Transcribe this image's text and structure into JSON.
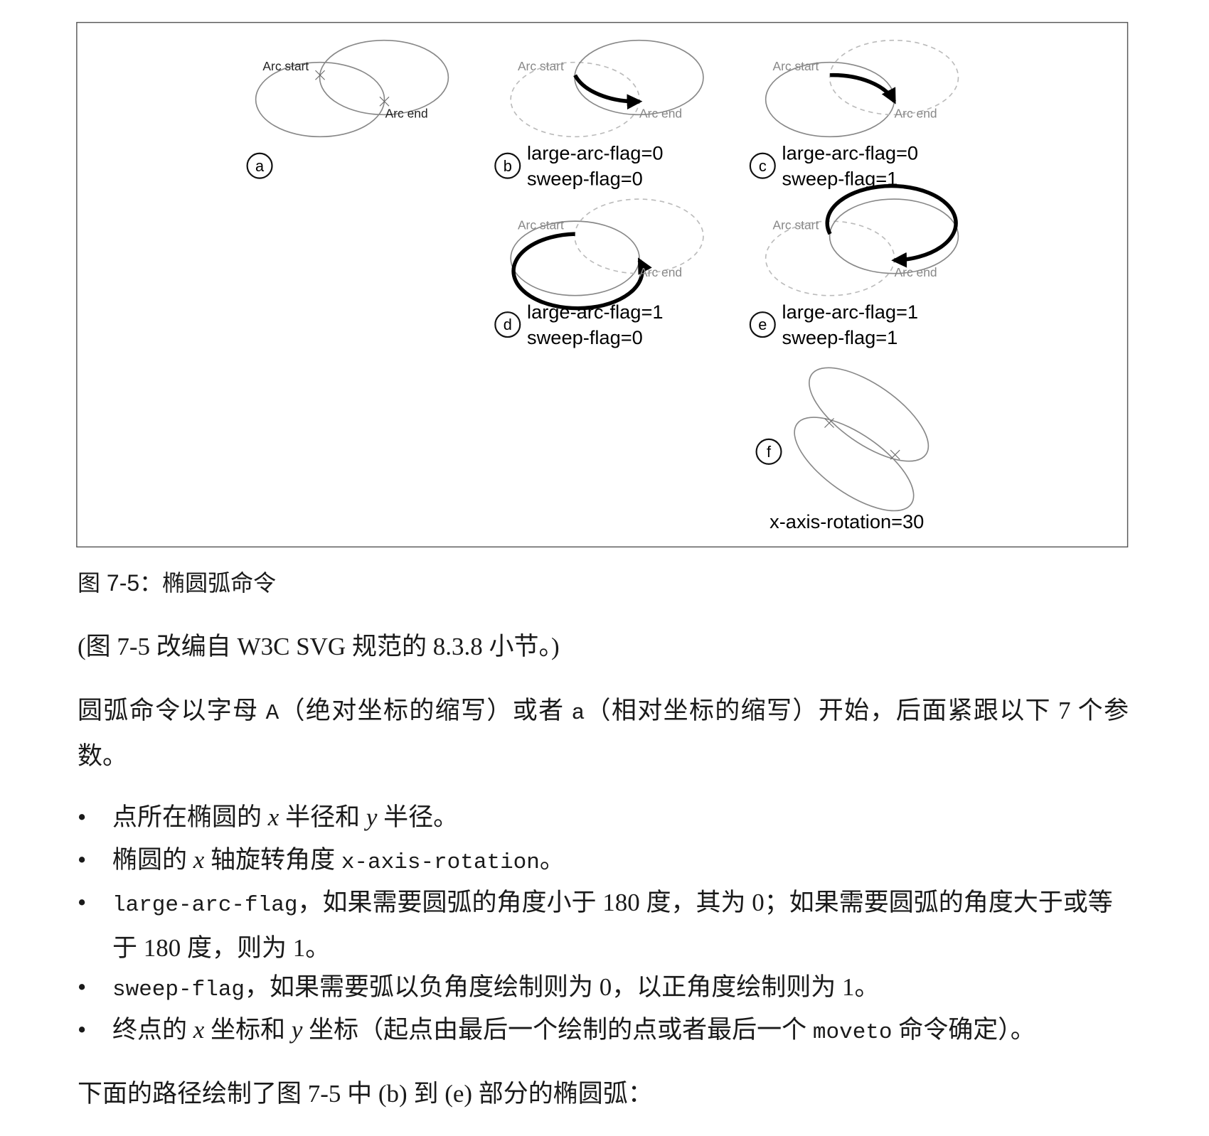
{
  "figure": {
    "arc_start": "Arc start",
    "arc_end": "Arc end",
    "panels": [
      {
        "letter": "a"
      },
      {
        "letter": "b",
        "line1": "large-arc-flag=0",
        "line2": "sweep-flag=0"
      },
      {
        "letter": "c",
        "line1": "large-arc-flag=0",
        "line2": "sweep-flag=1"
      },
      {
        "letter": "d",
        "line1": "large-arc-flag=1",
        "line2": "sweep-flag=0"
      },
      {
        "letter": "e",
        "line1": "large-arc-flag=1",
        "line2": "sweep-flag=1"
      },
      {
        "letter": "f",
        "line1": "x-axis-rotation=30"
      }
    ]
  },
  "caption": "图 7-5：椭圆弧命令",
  "source_note": "(图 7-5 改编自 W3C SVG 规范的 8.3.8 小节。)",
  "intro": {
    "a": "圆弧命令以字母 ",
    "code_A": "A",
    "b": "（绝对坐标的缩写）或者 ",
    "code_a": "a",
    "c": "（相对坐标的缩写）开始，后面紧跟以下 7 个参数。"
  },
  "bullets": {
    "b1": {
      "a": "点所在椭圆的 ",
      "x": "x",
      "b": " 半径和 ",
      "y": "y",
      "c": " 半径。"
    },
    "b2": {
      "a": "椭圆的 ",
      "x": "x",
      "b": " 轴旋转角度 ",
      "code": "x-axis-rotation",
      "c": "。"
    },
    "b3": {
      "code": "large-arc-flag",
      "a": "，如果需要圆弧的角度小于 180 度，其为 0；如果需要圆弧的角度大于或等于 180 度，则为 1。"
    },
    "b4": {
      "code": "sweep-flag",
      "a": "，如果需要弧以负角度绘制则为 0，以正角度绘制则为 1。"
    },
    "b5": {
      "a": "终点的 ",
      "x": "x",
      "b": " 坐标和 ",
      "y": "y",
      "c": " 坐标（起点由最后一个绘制的点或者最后一个 ",
      "code": "moveto",
      "d": " 命令确定）。"
    }
  },
  "bullet_char": "•",
  "closing": "下面的路径绘制了图 7-5 中 (b) 到 (e) 部分的椭圆弧："
}
